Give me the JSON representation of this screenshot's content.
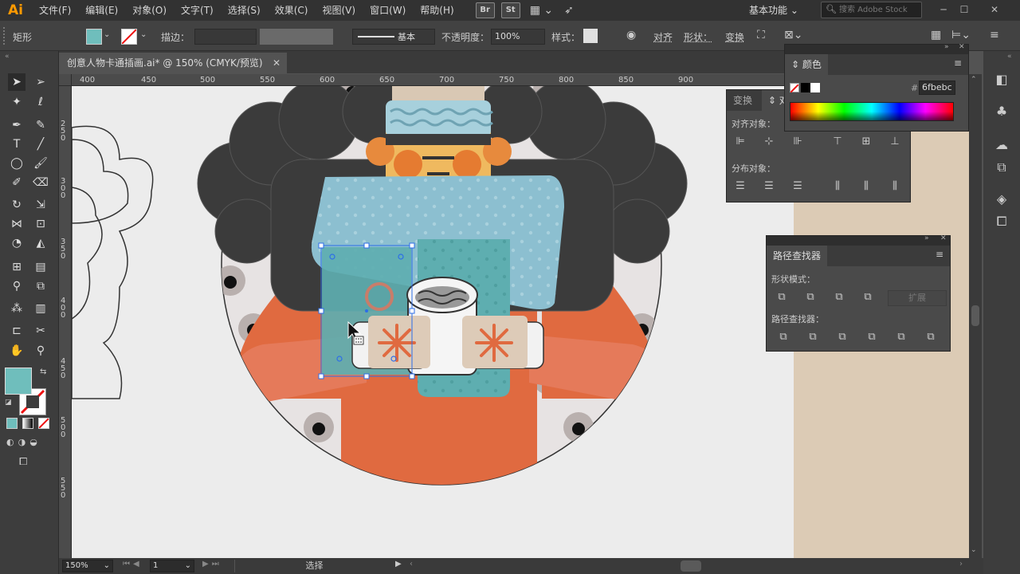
{
  "app": {
    "logo": "Ai"
  },
  "menubar": {
    "items": [
      "文件(F)",
      "编辑(E)",
      "对象(O)",
      "文字(T)",
      "选择(S)",
      "效果(C)",
      "视图(V)",
      "窗口(W)",
      "帮助(H)"
    ],
    "bridge": "Br",
    "stock": "St",
    "workspace": "基本功能",
    "search_placeholder": "搜索 Adobe Stock"
  },
  "controlbar": {
    "object_type": "矩形",
    "stroke_label": "描边：",
    "stroke_style": "基本",
    "opacity_label": "不透明度：",
    "opacity_value": "100%",
    "style_label": "样式：",
    "align_label": "对齐",
    "shape_label": "形状：",
    "transform_label": "变换",
    "fill_color": "#6fbebc"
  },
  "document": {
    "tab_title": "创意人物卡通插画.ai* @ 150% (CMYK/预览)"
  },
  "rulers": {
    "h_ticks": [
      "400",
      "450",
      "500",
      "550",
      "600",
      "650",
      "700",
      "750",
      "800",
      "850",
      "900"
    ],
    "v_ticks": [
      "250",
      "300",
      "350",
      "400",
      "450",
      "500",
      "550"
    ]
  },
  "color_panel": {
    "title": "颜色",
    "hex_label": "#",
    "hex_value": "6fbebc"
  },
  "align_panel": {
    "tab_transform": "变换",
    "tab_align": "对",
    "align_objects_label": "对齐对象：",
    "distribute_objects_label": "分布对象："
  },
  "pathfinder_panel": {
    "title": "路径查找器",
    "shape_modes_label": "形状模式：",
    "expand_label": "扩展",
    "pathfinders_label": "路径查找器："
  },
  "statusbar": {
    "zoom": "150%",
    "artboard": "1",
    "tool_status": "选择"
  }
}
